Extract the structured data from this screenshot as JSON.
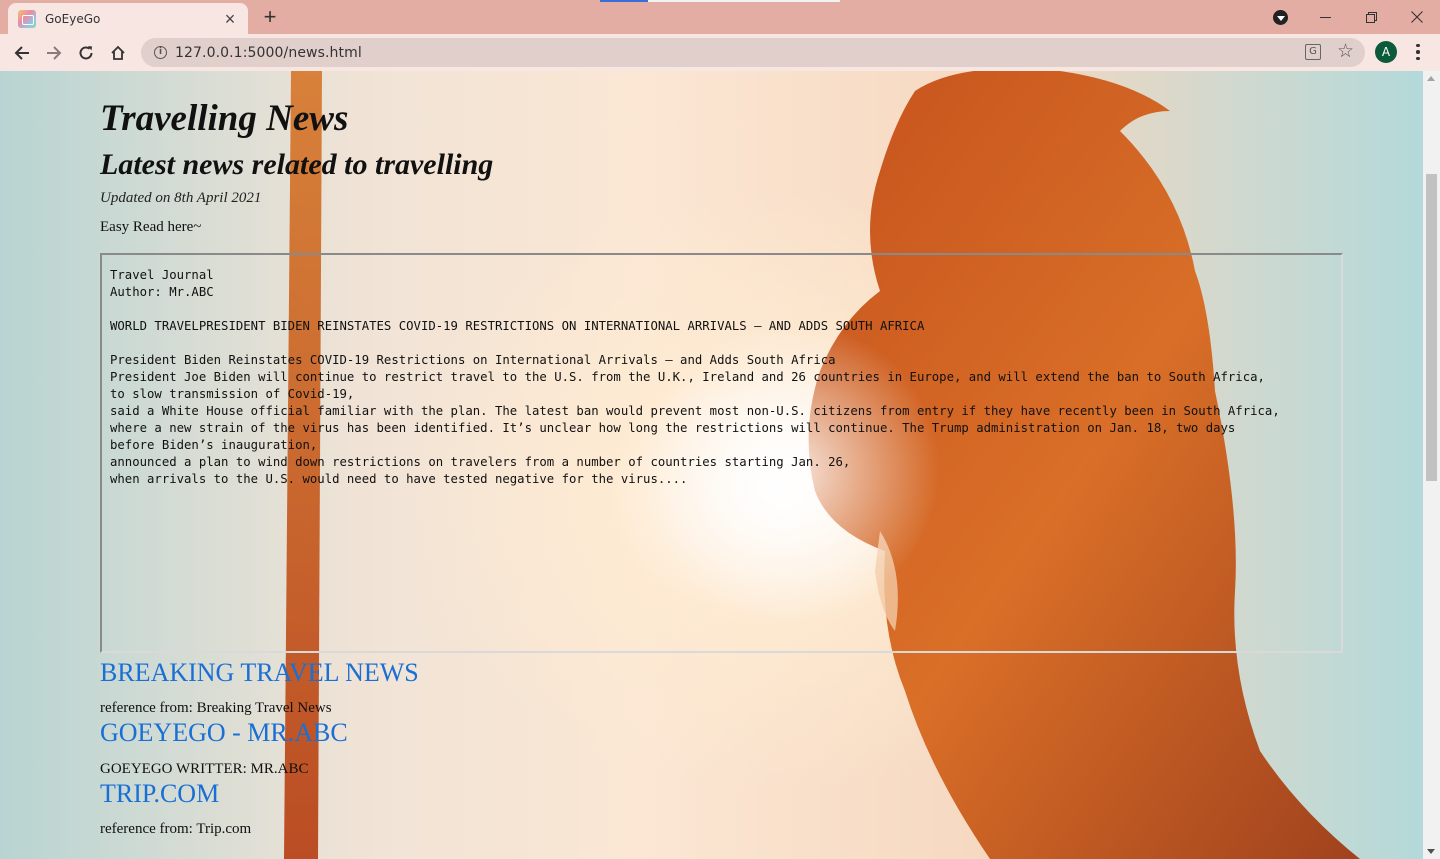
{
  "browser": {
    "tab_title": "GoEyeGo",
    "url": "127.0.0.1:5000/news.html",
    "avatar_letter": "A"
  },
  "page": {
    "title": "Travelling News",
    "subtitle": "Latest news related to travelling",
    "updated": "Updated on 8th April 2021",
    "easy_read": "Easy Read here~",
    "journal_text": "Travel Journal\nAuthor: Mr.ABC\n\nWORLD TRAVELPRESIDENT BIDEN REINSTATES COVID-19 RESTRICTIONS ON INTERNATIONAL ARRIVALS – AND ADDS SOUTH AFRICA\n\nPresident Biden Reinstates COVID-19 Restrictions on International Arrivals – and Adds South Africa\nPresident Joe Biden will continue to restrict travel to the U.S. from the U.K., Ireland and 26 countries in Europe, and will extend the ban to South Africa,\nto slow transmission of Covid-19,\nsaid a White House official familiar with the plan. The latest ban would prevent most non-U.S. citizens from entry if they have recently been in South Africa,\nwhere a new strain of the virus has been identified. It’s unclear how long the restrictions will continue. The Trump administration on Jan. 18, two days\nbefore Biden’s inauguration,\nannounced a plan to wind down restrictions on travelers from a number of countries starting Jan. 26,\nwhen arrivals to the U.S. would need to have tested negative for the virus....",
    "links": [
      {
        "label": "BREAKING TRAVEL NEWS",
        "caption": "reference from: Breaking Travel News"
      },
      {
        "label": "GOEYEGO - MR.ABC",
        "caption": "GOEYEGO WRITTER: MR.ABC"
      },
      {
        "label": "TRIP.COM",
        "caption": "reference from: Trip.com"
      }
    ]
  },
  "colors": {
    "tabbar": "#e4ada3",
    "toolbar": "#f8e6e2",
    "link": "#1a6fd4",
    "silhouette": "#c2561e"
  }
}
